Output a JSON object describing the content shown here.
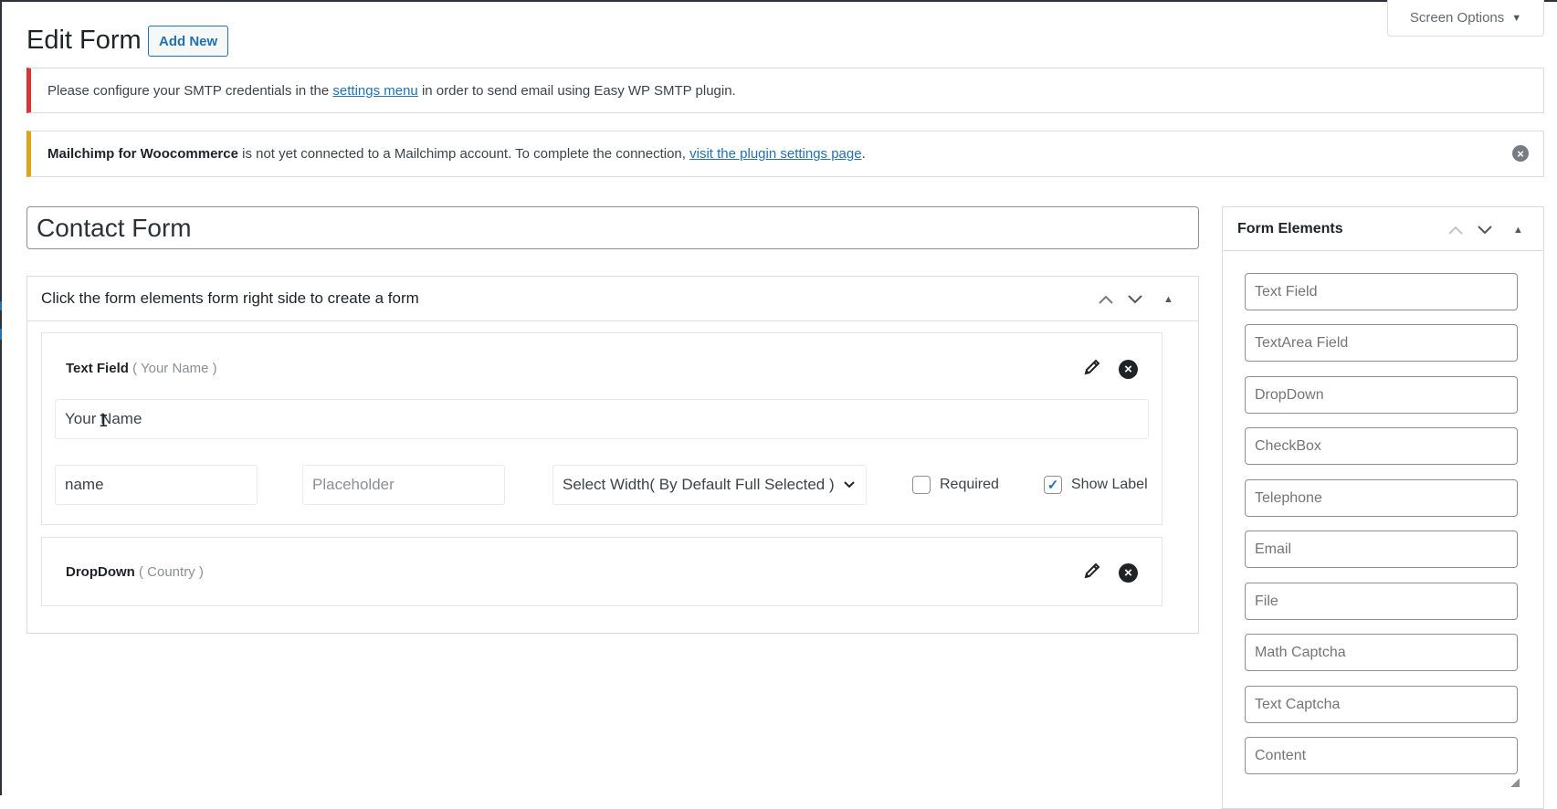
{
  "page": {
    "title": "Edit Form",
    "add_new_label": "Add New",
    "screen_options_label": "Screen Options"
  },
  "notices": {
    "smtp": {
      "text_before": "Please configure your SMTP credentials in the ",
      "link_text": "settings menu",
      "text_after": " in order to send email using Easy WP SMTP plugin."
    },
    "mailchimp": {
      "bold": "Mailchimp for Woocommerce",
      "text_before": " is not yet connected to a Mailchimp account. To complete the connection, ",
      "link_text": "visit the plugin settings page",
      "text_after": "."
    }
  },
  "form": {
    "title_value": "Contact Form",
    "builder_header": "Click the form elements form right side to create a form",
    "fields": [
      {
        "type_label": "Text Field",
        "name_label": "( Your Name )",
        "label_value": "Your Name",
        "name_value": "name",
        "placeholder_placeholder": "Placeholder",
        "width_select_value": "Select Width( By Default Full Selected )",
        "required_label": "Required",
        "required_checked": false,
        "show_label_label": "Show Label",
        "show_label_checked": true
      },
      {
        "type_label": "DropDown",
        "name_label": "( Country )"
      }
    ]
  },
  "sidebar": {
    "title": "Form Elements",
    "elements": [
      "Text Field",
      "TextArea Field",
      "DropDown",
      "CheckBox",
      "Telephone",
      "Email",
      "File",
      "Math Captcha",
      "Text Captcha",
      "Content"
    ]
  },
  "colors": {
    "accent": "#2271b1",
    "error_notice": "#d63638",
    "warning_notice": "#dba617"
  }
}
